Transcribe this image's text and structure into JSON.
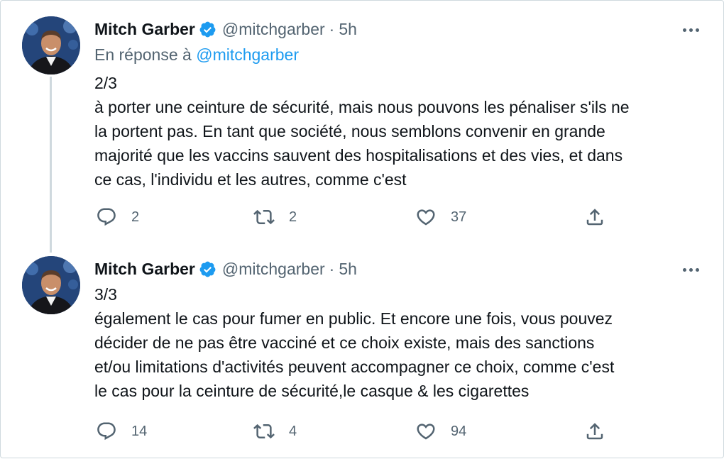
{
  "tweets": [
    {
      "author_name": "Mitch Garber",
      "handle": "@mitchgarber",
      "separator": "·",
      "time": "5h",
      "reply_prefix": "En réponse à",
      "reply_mention": "@mitchgarber",
      "lines": [
        "2/3",
        "à porter une ceinture de sécurité, mais nous pouvons les pénaliser s'ils ne",
        "la portent pas. En tant que société, nous semblons convenir en grande",
        "majorité que les vaccins sauvent des hospitalisations et des vies, et dans",
        "ce cas, l'individu et les autres, comme c'est"
      ],
      "reply_count": "2",
      "retweet_count": "2",
      "like_count": "37"
    },
    {
      "author_name": "Mitch Garber",
      "handle": "@mitchgarber",
      "separator": "·",
      "time": "5h",
      "lines": [
        "3/3",
        "également le cas pour fumer en public. Et encore une fois, vous pouvez",
        "décider de ne pas être vacciné et ce choix existe, mais des sanctions",
        "et/ou limitations d'activités peuvent accompagner ce choix, comme c'est",
        "le cas pour la ceinture de sécurité,le casque & les cigarettes"
      ],
      "reply_count": "14",
      "retweet_count": "4",
      "like_count": "94"
    }
  ],
  "icons": {
    "verified": "verified-badge-icon",
    "more": "more-options-icon",
    "reply": "reply-icon",
    "retweet": "retweet-icon",
    "like": "heart-icon",
    "share": "share-icon"
  },
  "colors": {
    "text": "#0f1419",
    "secondary": "#536471",
    "accent": "#1d9bf0",
    "border": "#cfd9de"
  }
}
